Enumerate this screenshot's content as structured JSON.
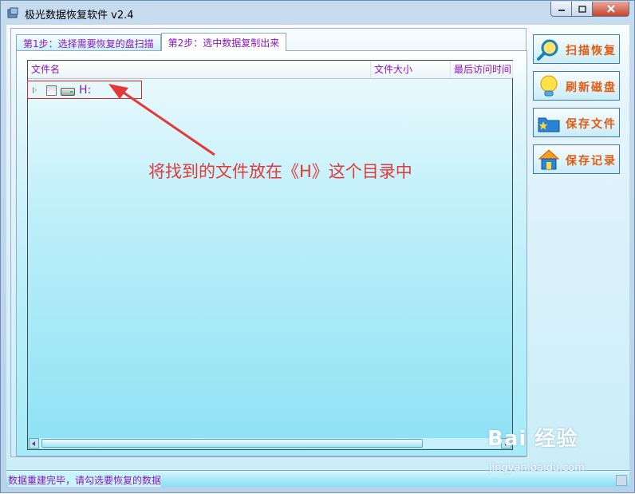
{
  "window": {
    "title": "极光数据恢复软件 v2.4"
  },
  "tabs": [
    {
      "label": "第1步：选择需要恢复的盘扫描"
    },
    {
      "label": "第2步：选中数据复制出来"
    }
  ],
  "list": {
    "columns": [
      {
        "label": "文件名"
      },
      {
        "label": "文件大小"
      },
      {
        "label": "最后访问时间"
      }
    ],
    "rows": [
      {
        "label": "H:",
        "checked": false,
        "expanded": false
      }
    ]
  },
  "buttons": [
    {
      "label": "扫描恢复",
      "icon": "magnifier-icon"
    },
    {
      "label": "刷新磁盘",
      "icon": "bulb-icon"
    },
    {
      "label": "保存文件",
      "icon": "folder-star-icon"
    },
    {
      "label": "保存记录",
      "icon": "house-icon"
    }
  ],
  "status": {
    "text": "数据重建完毕，请勾选要恢复的数据"
  },
  "annotation": {
    "text": "将找到的文件放在《H》这个目录中"
  },
  "watermark": {
    "logo": "Bai 经验",
    "url": "jingyan.baidu.com"
  },
  "colors": {
    "accent_text": "#8a15c2",
    "button_text": "#e45a11",
    "annotation": "#e23a3a"
  }
}
